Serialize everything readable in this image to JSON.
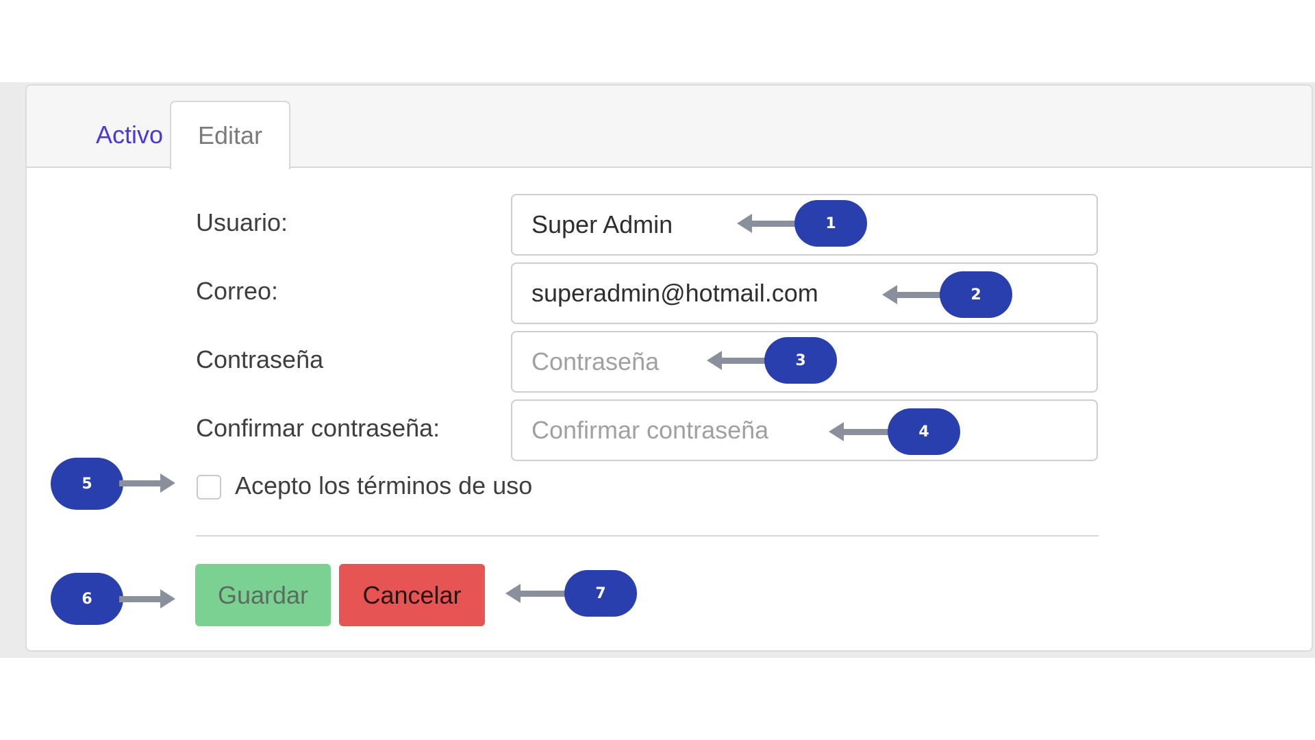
{
  "tabs": [
    {
      "label": "Activo",
      "active": false
    },
    {
      "label": "Editar",
      "active": true
    }
  ],
  "form": {
    "usuario": {
      "label": "Usuario:",
      "value": "Super Admin",
      "placeholder": ""
    },
    "correo": {
      "label": "Correo:",
      "value": "superadmin@hotmail.com",
      "placeholder": ""
    },
    "contrasena": {
      "label": "Contraseña",
      "value": "",
      "placeholder": "Contraseña"
    },
    "confirmar": {
      "label": "Confirmar contraseña:",
      "value": "",
      "placeholder": "Confirmar contraseña"
    },
    "terms": {
      "label": "Acepto los términos de uso",
      "checked": false
    }
  },
  "buttons": {
    "save_label": "Guardar",
    "cancel_label": "Cancelar"
  },
  "callouts": {
    "c1": "1",
    "c2": "2",
    "c3": "3",
    "c4": "4",
    "c5": "5",
    "c6": "6",
    "c7": "7"
  },
  "colors": {
    "active_tab_text": "#4b36d8",
    "save_button": "#7bd192",
    "cancel_button": "#e65454",
    "callout_badge": "#2a3fae",
    "callout_line": "#8a8f9c"
  }
}
